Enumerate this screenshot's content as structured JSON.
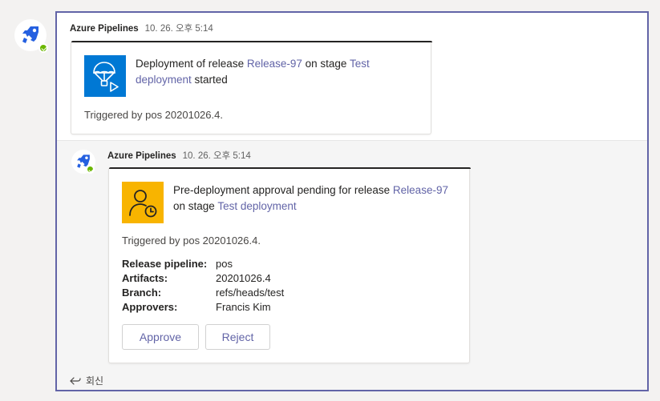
{
  "messages": [
    {
      "sender": "Azure Pipelines",
      "time": "10. 26. 오후 5:14",
      "card": {
        "title_prefix": "Deployment of release ",
        "release_link": "Release-97",
        "title_middle": " on stage ",
        "stage_link": "Test deployment",
        "title_suffix": " started",
        "triggered": "Triggered by pos 20201026.4."
      }
    },
    {
      "sender": "Azure Pipelines",
      "time": "10. 26. 오후 5:14",
      "card": {
        "title_prefix": "Pre-deployment approval pending for release ",
        "release_link": "Release-97",
        "title_middle": " on stage ",
        "stage_link": "Test deployment",
        "title_suffix": "",
        "triggered": "Triggered by pos 20201026.4.",
        "facts": [
          {
            "label": "Release pipeline:",
            "value": "pos",
            "is_link": true
          },
          {
            "label": "Artifacts:",
            "value": "20201026.4",
            "is_link": false
          },
          {
            "label": "Branch:",
            "value": "refs/heads/test",
            "is_link": false
          },
          {
            "label": "Approvers:",
            "value": "Francis Kim",
            "is_link": false
          }
        ],
        "actions": {
          "approve": "Approve",
          "reject": "Reject"
        }
      }
    }
  ],
  "reply": {
    "label": "회신"
  },
  "colors": {
    "brand": "#6264a7",
    "deploy_icon_bg": "#0078d4",
    "approval_icon_bg": "#f8b400",
    "presence": "#6bb700"
  },
  "icons": {
    "bot_avatar": "azure-pipelines-icon",
    "deploy": "parachute-play-icon",
    "approval": "person-clock-icon",
    "reply": "reply-arrow-icon"
  }
}
